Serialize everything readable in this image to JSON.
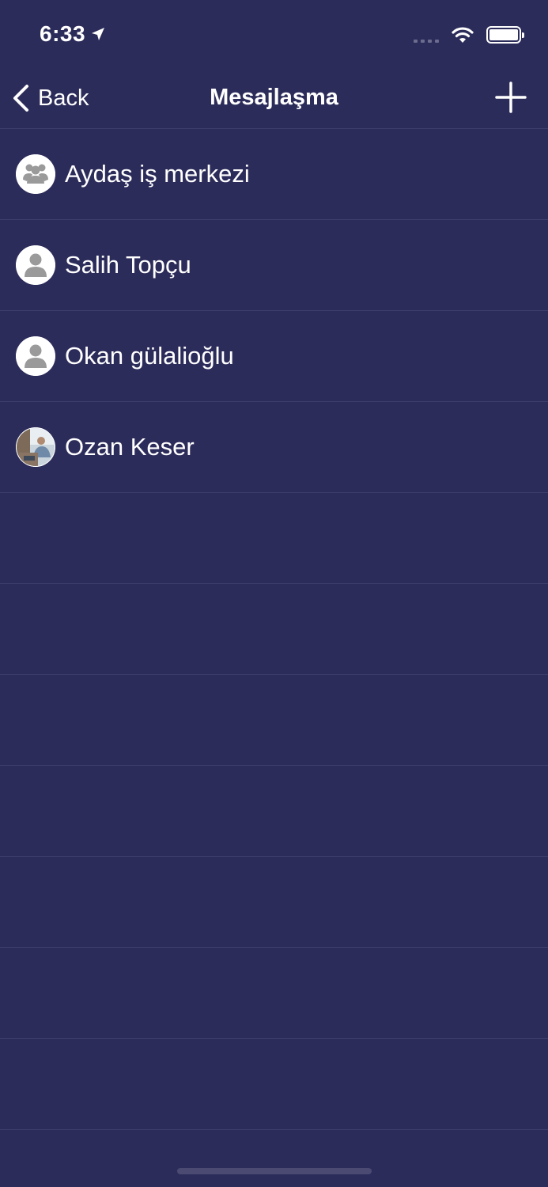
{
  "status_bar": {
    "time": "6:33"
  },
  "nav": {
    "back_label": "Back",
    "title": "Mesajlaşma"
  },
  "conversations": [
    {
      "name": "Aydaş iş merkezi",
      "avatar": "group-icon"
    },
    {
      "name": "Salih Topçu",
      "avatar": "person-icon"
    },
    {
      "name": "Okan gülalioğlu",
      "avatar": "person-icon"
    },
    {
      "name": "Ozan Keser",
      "avatar": "photo"
    }
  ],
  "colors": {
    "background": "#2c2c5b",
    "divider": "#3d3d6e",
    "avatar_icon": "#9a9a9a"
  }
}
